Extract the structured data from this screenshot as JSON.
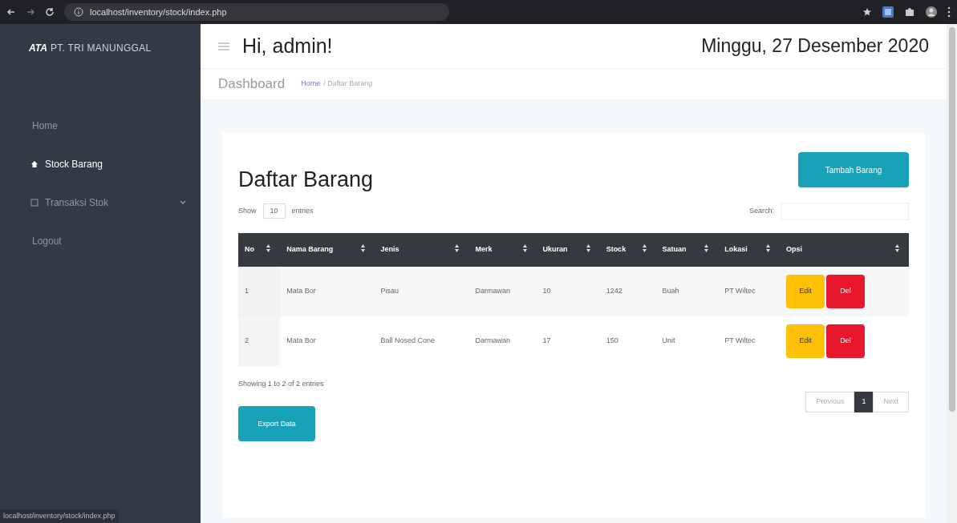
{
  "browser": {
    "url": "localhost/inventory/stock/index.php",
    "status_url": "localhost/inventory/stock/index.php"
  },
  "sidebar": {
    "brand": "PT. TRI MANUNGGAL",
    "logo": "ATA",
    "items": [
      {
        "label": "Home",
        "selected": false,
        "kind": "plain",
        "expandable": false
      },
      {
        "label": "Stock Barang",
        "selected": true,
        "kind": "home",
        "expandable": false
      },
      {
        "label": "Transaksi Stok",
        "selected": false,
        "kind": "square",
        "expandable": true
      },
      {
        "label": "Logout",
        "selected": false,
        "kind": "plain",
        "expandable": false
      }
    ]
  },
  "header": {
    "greeting": "Hi, admin!",
    "date": "Minggu, 27 Desember 2020",
    "page_title": "Dashboard",
    "breadcrumb": [
      {
        "label": "Home",
        "link": true
      },
      {
        "label": "/ Daftar Barang",
        "link": false
      }
    ]
  },
  "card": {
    "title": "Daftar Barang",
    "add_button": "Tambah Barang",
    "show_label": "Show",
    "page_size": "10",
    "entries_label": "entries",
    "search_label": "Search:",
    "table": {
      "columns": [
        "No",
        "Nama Barang",
        "Jenis",
        "Merk",
        "Ukuran",
        "Stock",
        "Satuan",
        "Lokasi",
        "Opsi"
      ],
      "rows": [
        {
          "cells": [
            "1",
            "Mata Bor",
            "Pisau",
            "Darmawan",
            "10",
            "1242",
            "Buah",
            "PT Wiltec"
          ],
          "edit_label": "Edit",
          "delete_label": "Del"
        },
        {
          "cells": [
            "2",
            "Mata Bor",
            "Ball Nosed Cone",
            "Darmawan",
            "17",
            "150",
            "Unit",
            "PT Wiltec"
          ],
          "edit_label": "Edit",
          "delete_label": "Del"
        }
      ]
    },
    "info": "Showing 1 to 2 of 2 entries",
    "pagination": [
      {
        "label": "Previous",
        "kind": "nav",
        "selected": false
      },
      {
        "label": "1",
        "kind": "page",
        "selected": true
      },
      {
        "label": "Next",
        "kind": "nav",
        "selected": false
      }
    ],
    "export_button": "Export Data"
  }
}
